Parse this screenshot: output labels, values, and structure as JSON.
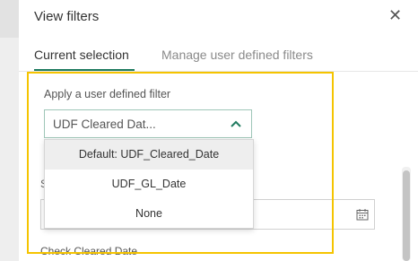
{
  "dialog": {
    "title": "View filters",
    "close_icon": "close-icon"
  },
  "tabs": [
    {
      "label": "Current selection",
      "active": true
    },
    {
      "label": "Manage user defined filters",
      "active": false
    }
  ],
  "filter": {
    "label": "Apply a user defined filter",
    "selected_value": "UDF Cleared Dat...",
    "options": [
      "Default: UDF_Cleared_Date",
      "UDF_GL_Date",
      "None"
    ]
  },
  "background": {
    "partial_label": "S",
    "date_field_icon": "calendar-icon",
    "check_label": "Check Cleared Date"
  },
  "colors": {
    "accent": "#1f7a5f",
    "highlight_border": "#f5c400"
  }
}
